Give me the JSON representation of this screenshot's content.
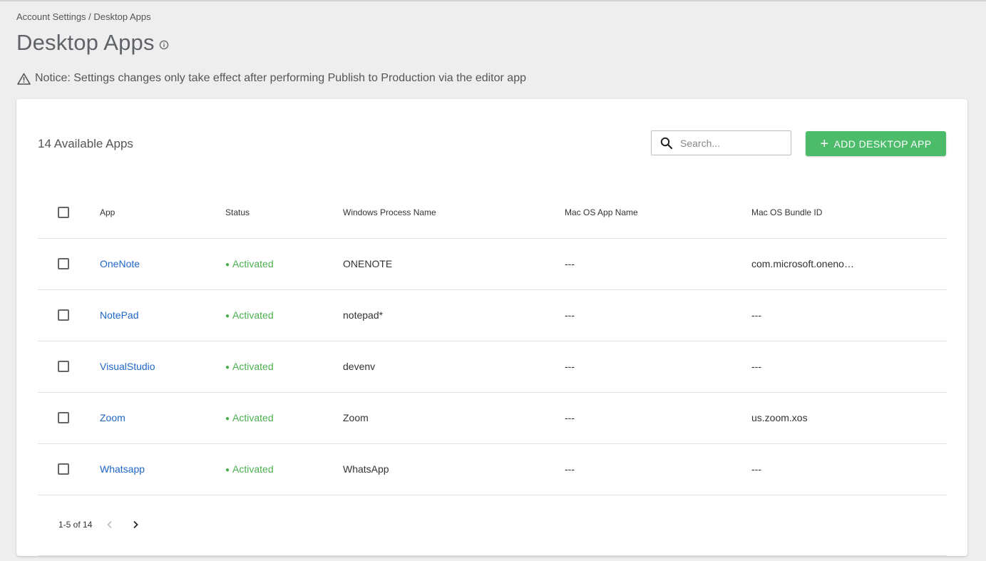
{
  "breadcrumb": "Account Settings / Desktop Apps",
  "page_title": "Desktop Apps",
  "notice": "Notice: Settings changes only take effect after performing Publish to Production via the editor app",
  "count_label": "14 Available Apps",
  "search": {
    "placeholder": "Search..."
  },
  "add_button_label": "ADD DESKTOP APP",
  "table": {
    "headers": [
      "App",
      "Status",
      "Windows Process Name",
      "Mac OS App Name",
      "Mac OS Bundle ID"
    ],
    "rows": [
      {
        "app": "OneNote",
        "status": "Activated",
        "win": "ONENOTE",
        "mac_name": "---",
        "bundle": "com.microsoft.oneno…"
      },
      {
        "app": "NotePad",
        "status": "Activated",
        "win": "notepad*",
        "mac_name": "---",
        "bundle": "---"
      },
      {
        "app": "VisualStudio",
        "status": "Activated",
        "win": "devenv",
        "mac_name": "---",
        "bundle": "---"
      },
      {
        "app": "Zoom",
        "status": "Activated",
        "win": "Zoom",
        "mac_name": "---",
        "bundle": "us.zoom.xos"
      },
      {
        "app": "Whatsapp",
        "status": "Activated",
        "win": "WhatsApp",
        "mac_name": "---",
        "bundle": "---"
      }
    ]
  },
  "pagination": {
    "range": "1-5 of 14"
  },
  "colors": {
    "accent_green": "#4cbb6a",
    "status_green": "#4caf50",
    "link_blue": "#1e66c9"
  },
  "icons": [
    "info-icon",
    "warning-icon",
    "search-icon",
    "plus-icon",
    "chevron-left-icon",
    "chevron-right-icon"
  ]
}
